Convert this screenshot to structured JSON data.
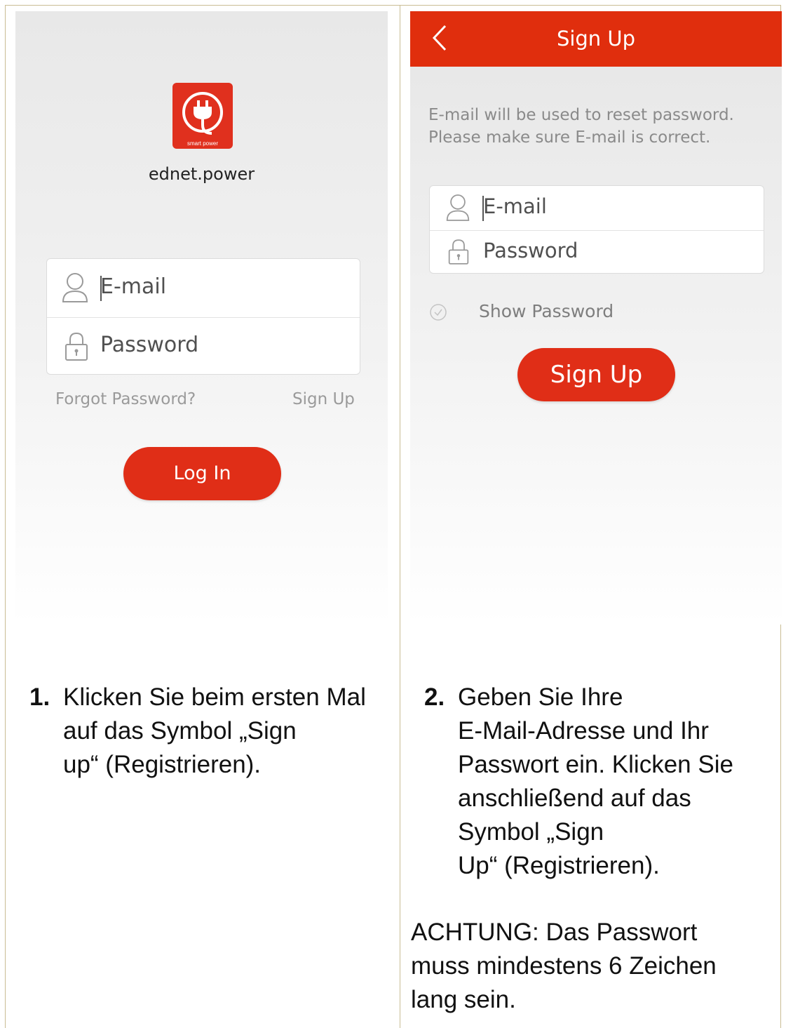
{
  "screen1": {
    "logo_caption": "smart power",
    "app_name": "ednet.power",
    "email_placeholder": "E-mail",
    "password_placeholder": "Password",
    "forgot_password": "Forgot Password?",
    "sign_up_link": "Sign Up",
    "login_button": "Log In"
  },
  "screen2": {
    "title": "Sign Up",
    "hint": "E-mail will be used to reset password. Please make sure E-mail is correct.",
    "email_placeholder": "E-mail",
    "password_placeholder": "Password",
    "show_password": "Show Password",
    "sign_up_button": "Sign Up"
  },
  "steps": [
    {
      "number": "1.",
      "text": "Klicken Sie beim ersten Mal\nauf das Symbol „Sign\nup“ (Registrieren)."
    },
    {
      "number": "2.",
      "text": "Geben Sie Ihre\nE-Mail-Adresse und Ihr\nPasswort ein. Klicken Sie\nanschließend auf das\nSymbol „Sign\nUp“ (Registrieren)."
    }
  ],
  "note": "ACHTUNG: Das Passwort\nmuss mindestens 6 Zeichen\nlang sein.",
  "colors": {
    "accent": "#e02e17",
    "border": "#c9bd94"
  },
  "icons": [
    "plug-icon",
    "user-icon",
    "lock-icon",
    "chevron-left-icon",
    "check-circle-icon"
  ]
}
